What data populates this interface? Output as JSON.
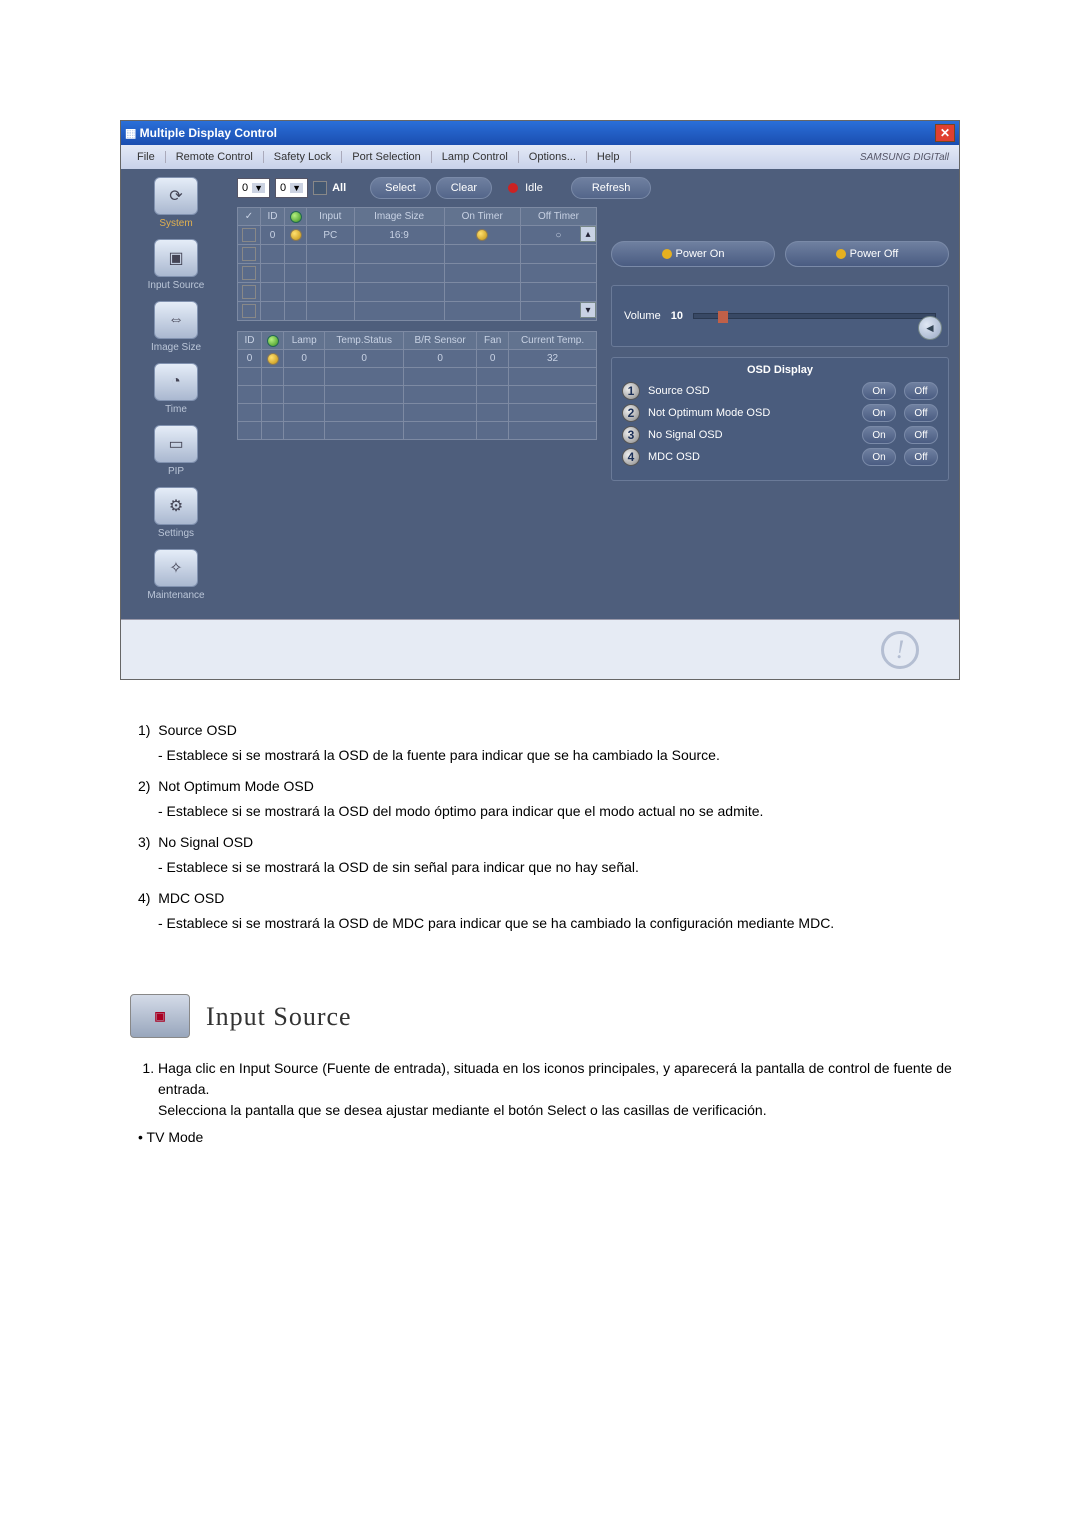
{
  "window": {
    "title": "Multiple Display Control",
    "brand": "SAMSUNG DIGITall"
  },
  "menus": [
    "File",
    "Remote Control",
    "Safety Lock",
    "Port Selection",
    "Lamp Control",
    "Options...",
    "Help"
  ],
  "sidebar": {
    "items": [
      {
        "label": "System",
        "glyph": "⟳"
      },
      {
        "label": "Input Source",
        "glyph": "▣"
      },
      {
        "label": "Image Size",
        "glyph": "⇔"
      },
      {
        "label": "Time",
        "glyph": "◔"
      },
      {
        "label": "PIP",
        "glyph": "▭"
      },
      {
        "label": "Settings",
        "glyph": "⚙"
      },
      {
        "label": "Maintenance",
        "glyph": "✧"
      }
    ]
  },
  "topbar": {
    "idA": "0",
    "idB": "0",
    "all": "All",
    "buttons": {
      "select": "Select",
      "clear": "Clear",
      "refresh": "Refresh"
    },
    "status_idle": "Idle"
  },
  "gridA": {
    "headers": [
      "",
      "ID",
      "",
      "Input",
      "Image Size",
      "On Timer",
      "Off Timer"
    ],
    "row": {
      "id": "0",
      "input": "PC",
      "imageSize": "16:9"
    }
  },
  "gridB": {
    "headers": [
      "ID",
      "",
      "Lamp",
      "Temp.Status",
      "B/R Sensor",
      "Fan",
      "Current Temp."
    ],
    "row": {
      "id": "0",
      "lamp": "0",
      "tempStatus": "0",
      "brSensor": "0",
      "fan": "0",
      "currentTemp": "32"
    }
  },
  "power": {
    "on": "Power On",
    "off": "Power Off"
  },
  "volume": {
    "label": "Volume",
    "value": "10"
  },
  "osd": {
    "title": "OSD Display",
    "rows": [
      {
        "n": "1",
        "label": "Source OSD",
        "on": "On",
        "off": "Off"
      },
      {
        "n": "2",
        "label": "Not Optimum Mode OSD",
        "on": "On",
        "off": "Off"
      },
      {
        "n": "3",
        "label": "No Signal OSD",
        "on": "On",
        "off": "Off"
      },
      {
        "n": "4",
        "label": "MDC OSD",
        "on": "On",
        "off": "Off"
      }
    ]
  },
  "doc": {
    "items": [
      {
        "num": "1)",
        "title": "Source OSD",
        "desc": "- Establece si se mostrará la OSD de la fuente para indicar que se ha cambiado la Source."
      },
      {
        "num": "2)",
        "title": "Not Optimum Mode OSD",
        "desc": "- Establece si se mostrará la OSD del modo óptimo para indicar que el modo actual no se admite."
      },
      {
        "num": "3)",
        "title": "No Signal OSD",
        "desc": "- Establece si se mostrará la OSD de sin señal para indicar que no hay señal."
      },
      {
        "num": "4)",
        "title": "MDC OSD",
        "desc": "- Establece si se mostrará la OSD de MDC para indicar que se ha cambiado la configuración mediante MDC."
      }
    ],
    "section_title": "Input Source",
    "ol1_a": "Haga clic en Input Source (Fuente de entrada), situada en los iconos principales, y aparecerá la pantalla de control de fuente de entrada.",
    "ol1_b": "Selecciona la pantalla que se desea ajustar mediante el botón Select o las casillas de verificación.",
    "bullet": "• TV Mode"
  }
}
